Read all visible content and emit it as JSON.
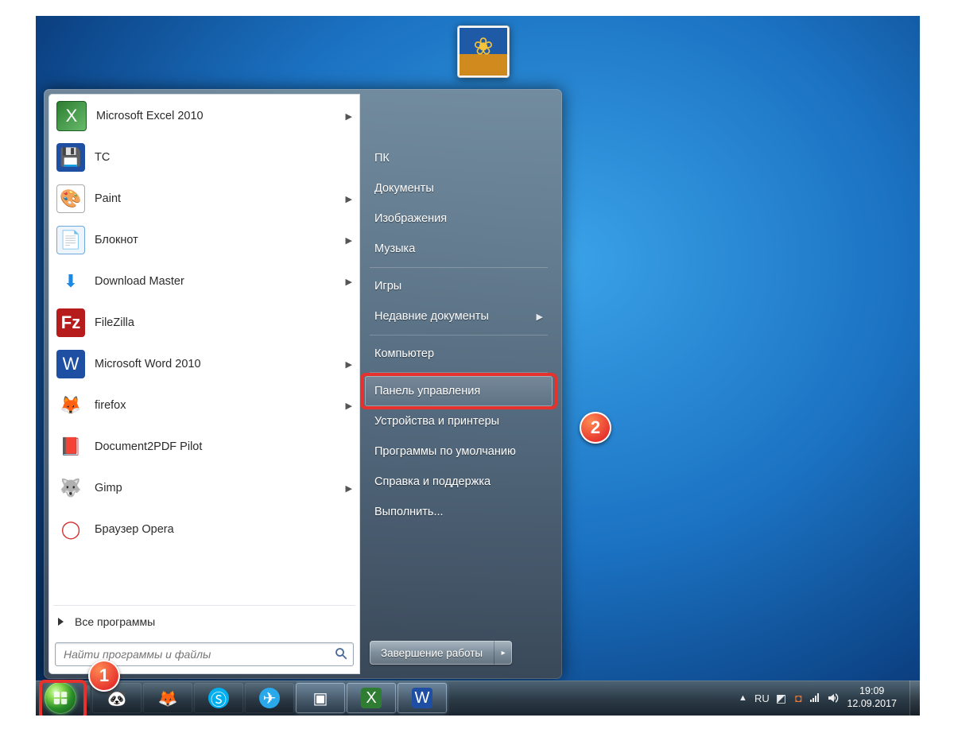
{
  "startmenu": {
    "apps": [
      {
        "label": "Microsoft Excel 2010",
        "icon": "excel-icon",
        "flyout": true
      },
      {
        "label": "TC",
        "icon": "save-icon",
        "flyout": false
      },
      {
        "label": "Paint",
        "icon": "paint-icon",
        "flyout": true
      },
      {
        "label": "Блокнот",
        "icon": "notepad-icon",
        "flyout": true
      },
      {
        "label": "Download Master",
        "icon": "download-icon",
        "flyout": true
      },
      {
        "label": "FileZilla",
        "icon": "filezilla-icon",
        "flyout": false
      },
      {
        "label": "Microsoft Word 2010",
        "icon": "word-icon",
        "flyout": true
      },
      {
        "label": "firefox",
        "icon": "firefox-icon",
        "flyout": true
      },
      {
        "label": "Document2PDF Pilot",
        "icon": "pdf-icon",
        "flyout": false
      },
      {
        "label": "Gimp",
        "icon": "gimp-icon",
        "flyout": true
      },
      {
        "label": "Браузер Opera",
        "icon": "opera-icon",
        "flyout": false
      }
    ],
    "all_programs": "Все программы",
    "search_placeholder": "Найти программы и файлы"
  },
  "rightpane": {
    "group1": [
      "ПК",
      "Документы",
      "Изображения",
      "Музыка"
    ],
    "group2": [
      {
        "label": "Игры",
        "flyout": false
      },
      {
        "label": "Недавние документы",
        "flyout": true
      }
    ],
    "group3": [
      "Компьютер"
    ],
    "group4_highlight": "Панель управления",
    "group4_rest": [
      "Устройства и принтеры",
      "Программы по умолчанию",
      "Справка и поддержка",
      "Выполнить..."
    ],
    "shutdown": "Завершение работы"
  },
  "taskbar": {
    "items": [
      {
        "name": "panda",
        "glyph": "🐼"
      },
      {
        "name": "firefox",
        "glyph": "🦊"
      },
      {
        "name": "skype",
        "glyph": "Ⓢ"
      },
      {
        "name": "telegram",
        "glyph": "✈"
      },
      {
        "name": "console",
        "glyph": "▣"
      },
      {
        "name": "excel",
        "glyph": "X"
      },
      {
        "name": "word",
        "glyph": "W"
      }
    ],
    "lang": "RU",
    "time": "19:09",
    "date": "12.09.2017"
  },
  "callouts": {
    "c1": "1",
    "c2": "2"
  }
}
